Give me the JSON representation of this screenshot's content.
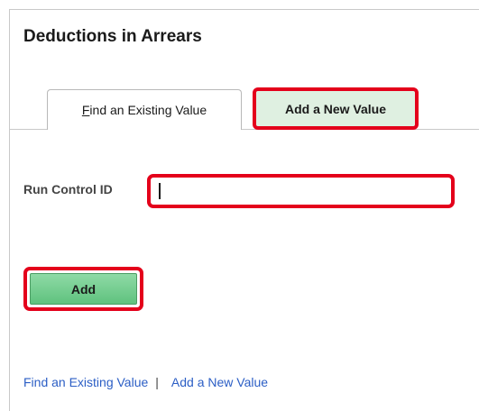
{
  "page": {
    "title": "Deductions in Arrears"
  },
  "tabs": [
    {
      "label": "Find an Existing Value",
      "hotkey_underline": "F",
      "active": false
    },
    {
      "label": "Add a New Value",
      "active": true
    }
  ],
  "form": {
    "run_control_label": "Run Control ID",
    "run_control_value": ""
  },
  "actions": {
    "add_label": "Add"
  },
  "footer": {
    "find_link": "Find an Existing Value",
    "separator": "|",
    "add_link": "Add a New Value"
  },
  "colors": {
    "highlight_border": "#e4001b",
    "active_tab_bg": "#dff0e1",
    "add_button_green": "#6fcb8b",
    "link_blue": "#2b5ec5"
  }
}
